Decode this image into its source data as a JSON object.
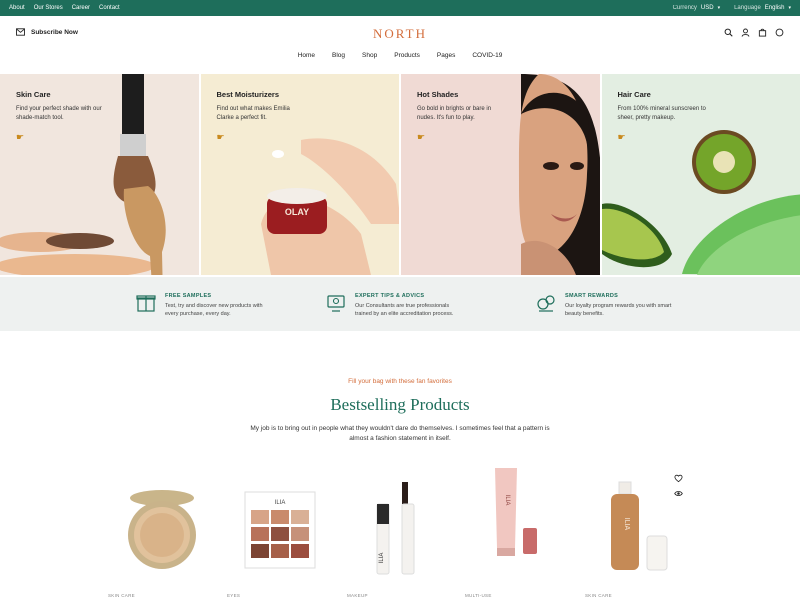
{
  "topbar": {
    "links": [
      "About",
      "Our Stores",
      "Career",
      "Contact"
    ],
    "currency_label": "Currency",
    "currency_value": "USD",
    "language_label": "Language",
    "language_value": "English"
  },
  "header": {
    "subscribe": "Subscribe Now",
    "logo": "NORTH",
    "nav": [
      "Home",
      "Blog",
      "Shop",
      "Products",
      "Pages",
      "COVID-19"
    ]
  },
  "hero": [
    {
      "title": "Skin Care",
      "desc": "Find your perfect shade with our shade-match tool.",
      "bg": "#f1e6de"
    },
    {
      "title": "Best Moisturizers",
      "desc": "Find out what makes Emilia Clarke a perfect fit.",
      "bg": "#f5ecd3"
    },
    {
      "title": "Hot Shades",
      "desc": "Go bold in brights or bare in nudes. It's fun to play.",
      "bg": "#f0dad4"
    },
    {
      "title": "Hair Care",
      "desc": "From 100% mineral sunscreen to sheer, pretty makeup.",
      "bg": "#e3eee2"
    }
  ],
  "features": [
    {
      "title": "FREE SAMPLES",
      "desc": "Test, try and discover new products with every purchase, every day."
    },
    {
      "title": "EXPERT TIPS & ADVICS",
      "desc": "Our Consultants are true professionals trained by an elite accreditation process."
    },
    {
      "title": "SMART REWARDS",
      "desc": "Our loyalty program rewards you with smart beauty benefits."
    }
  ],
  "bestsellers": {
    "kicker": "Fill your bag with these fan favorites",
    "title": "Bestselling Products",
    "desc": "My job is to bring out in people what they wouldn't dare do themselves. I sometimes feel that a pattern is almost a fashion statement in itself."
  },
  "products": [
    {
      "category": "SKIN CARE"
    },
    {
      "category": "EYES"
    },
    {
      "category": "MAKEUP"
    },
    {
      "category": "MULTI-USE"
    },
    {
      "category": "SKIN CARE"
    }
  ],
  "colors": {
    "brand_green": "#1e6e5b",
    "accent_orange": "#d36d3b",
    "arrow_gold": "#c98a1e"
  },
  "icons": [
    "envelope-icon",
    "search-icon",
    "user-icon",
    "cart-icon",
    "circle-icon",
    "heart-icon",
    "eye-icon",
    "pointing-hand-icon"
  ]
}
